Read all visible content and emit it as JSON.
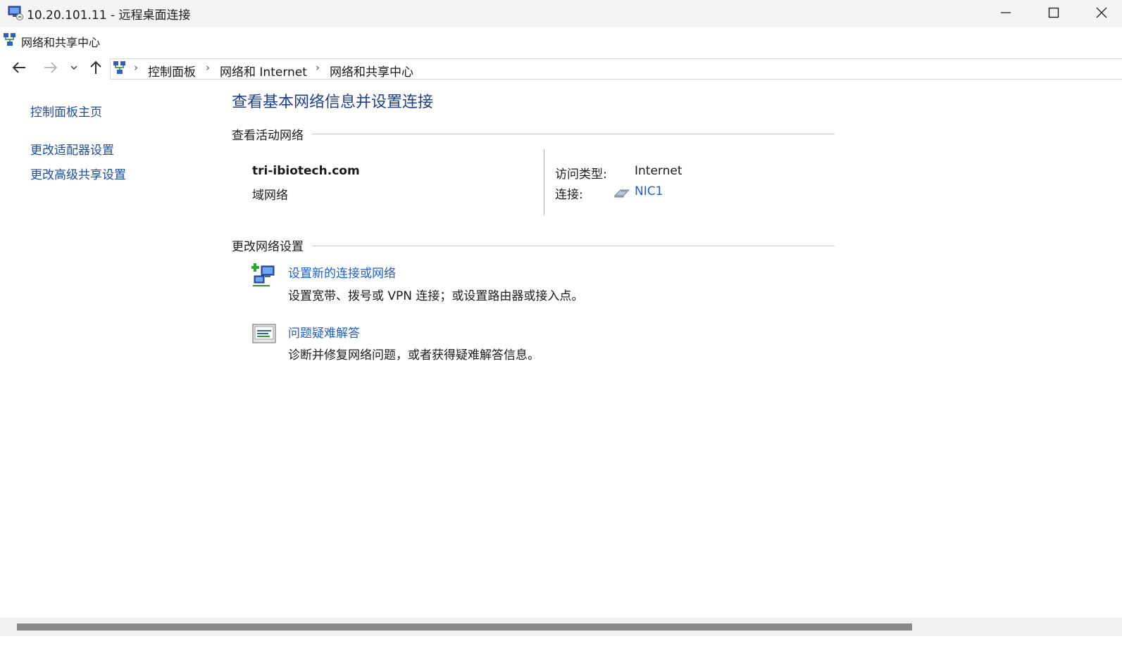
{
  "rdp_window": {
    "title": "10.20.101.11 - 远程桌面连接",
    "minimize_glyph": "—",
    "maximize_glyph": "☐",
    "close_glyph": "✕"
  },
  "window": {
    "title": "网络和共享中心"
  },
  "navigation": {
    "back_icon": "arrow-left-icon",
    "forward_icon": "arrow-right-icon",
    "recent_icon": "chevron-down-icon",
    "up_icon": "arrow-up-icon",
    "breadcrumb": [
      "控制面板",
      "网络和 Internet",
      "网络和共享中心"
    ]
  },
  "sidebar": {
    "items": [
      {
        "label": "控制面板主页"
      },
      {
        "label": "更改适配器设置"
      },
      {
        "label": "更改高级共享设置"
      }
    ]
  },
  "main": {
    "heading": "查看基本网络信息并设置连接",
    "active_networks": {
      "section_title": "查看活动网络",
      "network_name": "tri-ibiotech.com",
      "network_type": "域网络",
      "access_type_label": "访问类型:",
      "access_type_value": "Internet",
      "connection_label": "连接:",
      "connection_value": "NIC1"
    },
    "change_settings": {
      "section_title": "更改网络设置",
      "items": [
        {
          "link": "设置新的连接或网络",
          "description": "设置宽带、拨号或 VPN 连接；或设置路由器或接入点。",
          "icon": "new-connection-icon"
        },
        {
          "link": "问题疑难解答",
          "description": "诊断并修复网络问题，或者获得疑难解答信息。",
          "icon": "troubleshoot-icon"
        }
      ]
    }
  },
  "colors": {
    "link": "#2160c4",
    "heading": "#1e3f8f",
    "sidebar_link": "#1c4d9e"
  }
}
